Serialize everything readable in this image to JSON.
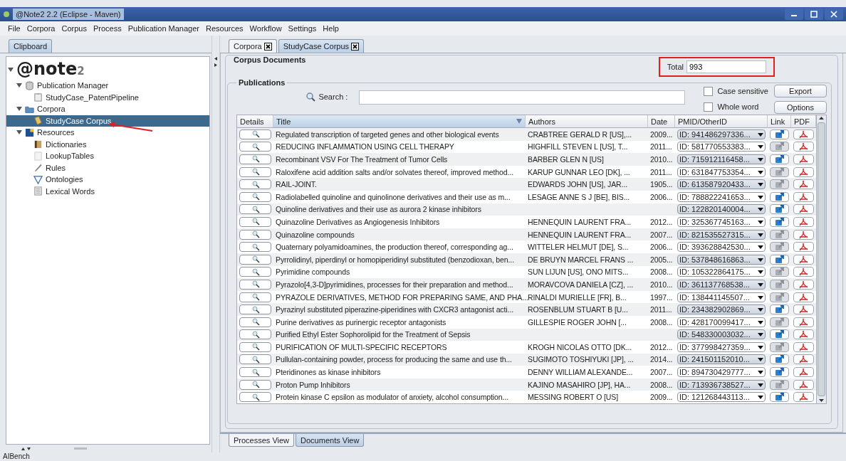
{
  "window": {
    "title": "@Note2 2.2 (Eclipse - Maven)"
  },
  "menu": [
    "File",
    "Corpora",
    "Corpus",
    "Process",
    "Publication Manager",
    "Resources",
    "Workflow",
    "Settings",
    "Help"
  ],
  "left_tabs": [
    {
      "label": "Clipboard",
      "selected": true
    }
  ],
  "tree": [
    {
      "label": "@note$_{2}$",
      "kind": "logo",
      "expanded": true,
      "selected": false,
      "children": [
        {
          "label": "Publication Manager",
          "kind": "database",
          "expanded": true,
          "selected": false,
          "children": [
            {
              "label": "StudyCase_PatentPipeline",
              "kind": "clipboard",
              "selected": false
            }
          ]
        },
        {
          "label": "Corpora",
          "kind": "folder",
          "expanded": true,
          "selected": false,
          "children": [
            {
              "label": "StudyCase Corpus",
              "kind": "corpus",
              "selected": true
            }
          ]
        },
        {
          "label": "Resources",
          "kind": "resources",
          "expanded": true,
          "selected": false,
          "children": [
            {
              "label": "Dictionaries",
              "kind": "dictionary",
              "selected": false
            },
            {
              "label": "LookupTables",
              "kind": "table",
              "selected": false
            },
            {
              "label": "Rules",
              "kind": "rules",
              "selected": false
            },
            {
              "label": "Ontologies",
              "kind": "ontology",
              "selected": false
            },
            {
              "label": "Lexical Words",
              "kind": "lexicon",
              "selected": false
            }
          ]
        }
      ]
    }
  ],
  "editor_tabs": [
    {
      "label": "Corpora",
      "selected": false
    },
    {
      "label": "StudyCase Corpus",
      "selected": true
    }
  ],
  "corpus_documents": {
    "title": "Corpus Documents",
    "total_label": "Total",
    "total": "993"
  },
  "publications": {
    "title": "Publications",
    "search_label": "Search :",
    "options": [
      {
        "label": "Case sensitive",
        "checked": false
      },
      {
        "label": "Whole word",
        "checked": false
      }
    ],
    "buttons": [
      "Export",
      "Options"
    ],
    "columns": [
      {
        "label": "Details",
        "sorted": false
      },
      {
        "label": "Title",
        "sorted": true
      },
      {
        "label": "Authors",
        "sorted": false
      },
      {
        "label": "Date",
        "sorted": false
      },
      {
        "label": "PMID/OtherID",
        "sorted": false
      },
      {
        "label": "Link",
        "sorted": false
      },
      {
        "label": "PDF",
        "sorted": false
      }
    ],
    "rows": [
      {
        "title": "Regulated transcription of targeted genes and other biological events",
        "authors": "CRABTREE GERALD R  [US],...",
        "date": "2009...",
        "id": "ID: 941486297336...",
        "link_available": true
      },
      {
        "title": "REDUCING INFLAMMATION USING CELL THERAPY",
        "authors": "HIGHFILL STEVEN L  [US],  T...",
        "date": "2011...",
        "id": "ID: 581770553383...",
        "link_available": false
      },
      {
        "title": "Recombinant VSV For The Treatment of Tumor Cells",
        "authors": "BARBER GLEN N  [US]",
        "date": "2010...",
        "id": "ID: 715912116458...",
        "link_available": true
      },
      {
        "title": "Raloxifene acid addition salts and/or solvates thereof, improved method...",
        "authors": "KARUP GUNNAR LEO  [DK],  ...",
        "date": "2011...",
        "id": "ID: 631847753354...",
        "link_available": false
      },
      {
        "title": "RAIL-JOINT.",
        "authors": "EDWARDS JOHN  [US],  JAR...",
        "date": "1905...",
        "id": "ID: 613587920433...",
        "link_available": false
      },
      {
        "title": "Radiolabelled quinoline and quinolinone derivatives and their use as m...",
        "authors": "LESAGE ANNE S J  [BE],  BIS...",
        "date": "2006...",
        "id": "ID: 788822241653...",
        "link_available": true
      },
      {
        "title": "Quinoline derivatives and their use as aurora 2 kinase inhibitors",
        "id": "ID: 122820140004...",
        "link_available": true
      },
      {
        "title": "Quinazoline Derivatives as Angiogenesis Inhibitors",
        "authors": "HENNEQUIN LAURENT FRA...",
        "date": "2012...",
        "id": "ID: 325367745163...",
        "link_available": true
      },
      {
        "title": "Quinazoline compounds",
        "authors": "HENNEQUIN LAURENT FRA...",
        "date": "2007...",
        "id": "ID: 821535527315...",
        "link_available": false
      },
      {
        "title": "Quaternary polyamidoamines, the production thereof, corresponding ag...",
        "authors": "WITTELER HELMUT  [DE],  S...",
        "date": "2006...",
        "id": "ID: 393628842530...",
        "link_available": false
      },
      {
        "title": "Pyrrolidinyl, piperdinyl or homopiperidinyl substituted (benzodioxan, ben...",
        "authors": "DE BRUYN MARCEL FRANS ...",
        "date": "2005...",
        "id": "ID: 537848616863...",
        "link_available": true
      },
      {
        "title": "Pyrimidine compounds",
        "authors": "SUN LIJUN  [US],  ONO MITS...",
        "date": "2008...",
        "id": "ID: 105322864175...",
        "link_available": false
      },
      {
        "title": "Pyrazolo[4,3-D]pyrimidines, processes for their preparation and method...",
        "authors": "MORAVCOVA DANIELA  [CZ],  ...",
        "date": "2010...",
        "id": "ID: 361137768538...",
        "link_available": false
      },
      {
        "title": "PYRAZOLE DERIVATIVES, METHOD FOR PREPARING SAME, AND PHA...",
        "authors": "RINALDI MURIELLE  [FR],  B...",
        "date": "1997...",
        "id": "ID: 138441145507...",
        "link_available": false
      },
      {
        "title": "Pyrazinyl substituted piperazine-piperidines with CXCR3 antagonist acti...",
        "authors": "ROSENBLUM STUART B  [U...",
        "date": "2011...",
        "id": "ID: 234382902869...",
        "link_available": true
      },
      {
        "title": "Purine derivatives as purinergic receptor antagonists",
        "authors": "GILLESPIE ROGER JOHN  [...",
        "date": "2008...",
        "id": "ID: 428170099417...",
        "link_available": false
      },
      {
        "title": "Purified Ethyl Ester Sophorolipid for the Treatment of Sepsis",
        "id": "ID: 548330003032...",
        "link_available": true
      },
      {
        "title": "PURIFICATION OF MULTI-SPECIFIC RECEPTORS",
        "authors": "KROGH NICOLAS OTTO  [DK...",
        "date": "2012...",
        "id": "ID: 377998427359...",
        "link_available": false
      },
      {
        "title": "Pullulan-containing powder, process for producing the same and use th...",
        "authors": "SUGIMOTO TOSHIYUKI  [JP],  ...",
        "date": "2014...",
        "id": "ID: 241501152010...",
        "link_available": true
      },
      {
        "title": "Pteridinones as kinase inhibitors",
        "authors": "DENNY WILLIAM ALEXANDE...",
        "date": "2007...",
        "id": "ID: 894730429777...",
        "link_available": true
      },
      {
        "title": "Proton Pump Inhibitors",
        "authors": "KAJINO MASAHIRO  [JP],  HA...",
        "date": "2008...",
        "id": "ID: 713936738527...",
        "link_available": false
      },
      {
        "title": "Protein kinase C epsilon as modulator of anxiety, alcohol consumption...",
        "authors": "MESSING ROBERT O  [US]",
        "date": "2009...",
        "id": "ID: 121268443113...",
        "link_available": true
      }
    ]
  },
  "bottom_tabs": [
    {
      "label": "Processes View",
      "selected": false
    },
    {
      "label": "Documents View",
      "selected": true
    }
  ],
  "status_bar": "AIBench"
}
